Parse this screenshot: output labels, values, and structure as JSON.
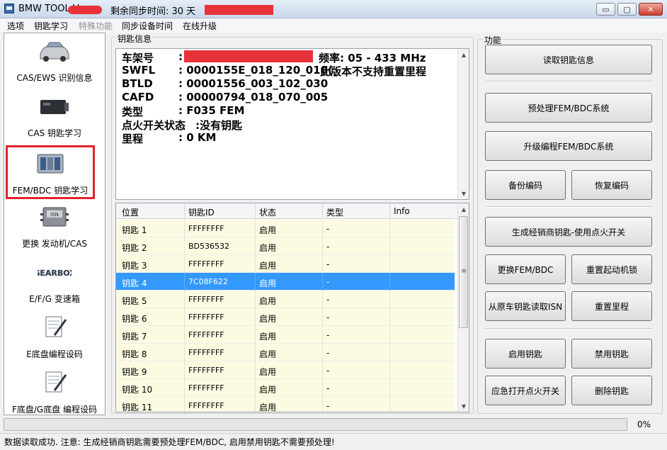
{
  "titlebar": {
    "title": "BMW TOOL V",
    "sync_text": "剩余同步时间: 30 天",
    "buttons": {
      "minimize": "▭",
      "restore": "▢",
      "close": "✕"
    }
  },
  "menu": [
    "选项",
    "钥匙学习",
    "特殊功能",
    "同步设备时间",
    "在线升级"
  ],
  "sidebar": [
    {
      "label": "CAS/EWS 识别信息",
      "icon": "car-icon"
    },
    {
      "label": "CAS 钥匙学习",
      "icon": "cas-module-icon"
    },
    {
      "label": "FEM/BDC 钥匙学习",
      "icon": "fem-module-icon"
    },
    {
      "label": "更换 发动机/CAS",
      "icon": "isn-chip-icon"
    },
    {
      "label": "E/F/G 变速箱",
      "icon": "gearbox-icon"
    },
    {
      "label": "E底盘编程设码",
      "icon": "document-pen-icon"
    },
    {
      "label": "F底盘/G底盘 编程设码",
      "icon": "document-pen-icon"
    }
  ],
  "key_info": {
    "legend": "钥匙信息",
    "lines": [
      {
        "label": "车架号",
        "value": ":"
      },
      {
        "label": "SWFL",
        "value": ": 0000155E_018_120_010("
      },
      {
        "label": "BTLD",
        "value": ": 00001556_003_102_030"
      },
      {
        "label": "CAFD",
        "value": ": 00000794_018_070_005"
      },
      {
        "label": "类型",
        "value": ": F035 FEM"
      },
      {
        "label": "点火开关状态",
        "value": ":没有钥匙"
      },
      {
        "label": "里程",
        "value": ": 0 KM"
      }
    ],
    "frequency": "频率: 05 - 433 MHz",
    "mileage_note": "此版本不支持重置里程"
  },
  "key_table": {
    "columns": [
      "位置",
      "钥匙ID",
      "状态",
      "类型",
      "Info"
    ],
    "selected_index": 3,
    "rows": [
      {
        "pos": "钥匙 1",
        "id": "FFFFFFFF",
        "status": "启用",
        "type": "-",
        "info": ""
      },
      {
        "pos": "钥匙 2",
        "id": "BD536532",
        "status": "启用",
        "type": "-",
        "info": ""
      },
      {
        "pos": "钥匙 3",
        "id": "FFFFFFFF",
        "status": "启用",
        "type": "-",
        "info": ""
      },
      {
        "pos": "钥匙 4",
        "id": "7C08F622",
        "status": "启用",
        "type": "-",
        "info": ""
      },
      {
        "pos": "钥匙 5",
        "id": "FFFFFFFF",
        "status": "启用",
        "type": "-",
        "info": ""
      },
      {
        "pos": "钥匙 6",
        "id": "FFFFFFFF",
        "status": "启用",
        "type": "-",
        "info": ""
      },
      {
        "pos": "钥匙 7",
        "id": "FFFFFFFF",
        "status": "启用",
        "type": "-",
        "info": ""
      },
      {
        "pos": "钥匙 8",
        "id": "FFFFFFFF",
        "status": "启用",
        "type": "-",
        "info": ""
      },
      {
        "pos": "钥匙 9",
        "id": "FFFFFFFF",
        "status": "启用",
        "type": "-",
        "info": ""
      },
      {
        "pos": "钥匙 10",
        "id": "FFFFFFFF",
        "status": "启用",
        "type": "-",
        "info": ""
      },
      {
        "pos": "钥匙 11",
        "id": "FFFFFFFF",
        "status": "启用",
        "type": "-",
        "info": ""
      }
    ]
  },
  "functions": {
    "legend": "功能",
    "read_key_info": "读取钥匙信息",
    "preprocess": "预处理FEM/BDC系统",
    "upgrade": "升级编程FEM/BDC系统",
    "backup": "备份编码",
    "restore": "恢复编码",
    "dealer_key": "生成经销商钥匙-使用点火开关",
    "replace_fem": "更换FEM/BDC",
    "reset_immo": "重置起动机锁",
    "read_isn": "从原车钥匙读取ISN",
    "reset_mileage": "重置里程",
    "enable_key": "启用钥匙",
    "disable_key": "禁用钥匙",
    "emergency_ignition": "应急打开点火开关",
    "delete_key": "删除钥匙"
  },
  "progress": {
    "percent_label": "0%",
    "value": 0
  },
  "status": "数据读取成功. 注意: 生成经销商钥匙需要预处理FEM/BDC, 启用禁用钥匙不需要预处理!",
  "colors": {
    "selection": "#3399ff",
    "row_bg": "#fcfbe2",
    "highlight_border": "#e0242a",
    "redaction": "#e8323a"
  }
}
